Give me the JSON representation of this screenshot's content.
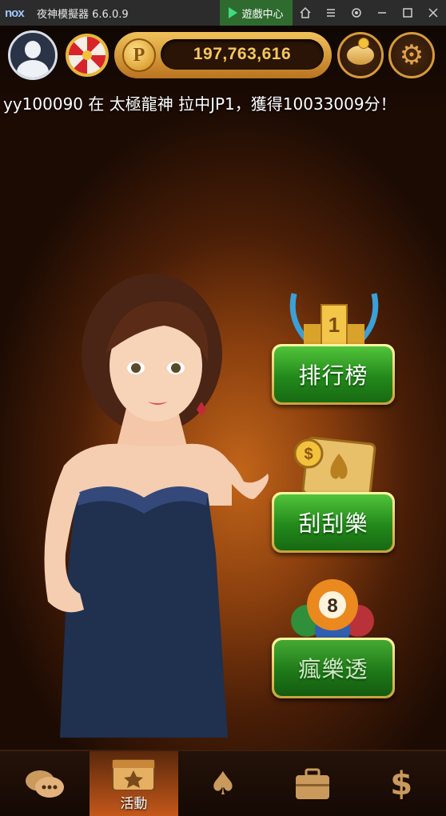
{
  "window": {
    "logo": "nox",
    "title": "夜神模擬器 6.6.0.9",
    "game_center_label": "遊戲中心",
    "buttons": [
      "home-icon",
      "menu-icon",
      "settings-icon",
      "minimize-icon",
      "maximize-icon",
      "close-icon"
    ]
  },
  "header": {
    "coins": "197,763,616",
    "coin_symbol": "P"
  },
  "marquee": {
    "text": "yy100090 在 太極龍神 拉中JP1，獲得10033009分！"
  },
  "menu": {
    "items": [
      {
        "label": "排行榜",
        "icon": "trophy-icon",
        "rank": "1"
      },
      {
        "label": "刮刮樂",
        "icon": "scratch-card-icon"
      },
      {
        "label": "瘋樂透",
        "icon": "lottery-balls-icon",
        "ball": "8"
      }
    ]
  },
  "bottom_nav": {
    "items": [
      {
        "label": "",
        "icon": "chat-icon"
      },
      {
        "label": "活動",
        "icon": "calendar-star-icon",
        "active": true
      },
      {
        "label": "",
        "icon": "spade-icon"
      },
      {
        "label": "",
        "icon": "briefcase-icon"
      },
      {
        "label": "",
        "icon": "dollar-icon",
        "glyph": "$"
      }
    ]
  },
  "colors": {
    "accent_gold": "#f3c85b",
    "button_green": "#23891b",
    "active_tab": "#c4581a"
  }
}
